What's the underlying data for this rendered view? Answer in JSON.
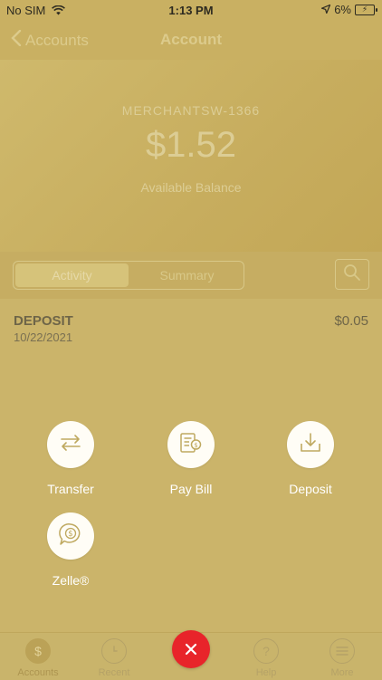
{
  "status_bar": {
    "carrier": "No SIM",
    "time": "1:13 PM",
    "battery": "6%"
  },
  "nav": {
    "back_label": "Accounts",
    "title": "Account"
  },
  "account": {
    "name": "MERCHANTSW-1366",
    "balance": "$1.52",
    "balance_label": "Available Balance"
  },
  "tabs_segment": {
    "activity": "Activity",
    "summary": "Summary"
  },
  "transactions": [
    {
      "title": "DEPOSIT",
      "date": "10/22/2021",
      "amount": "$0.05"
    }
  ],
  "quick_actions": [
    {
      "label": "Transfer",
      "icon": "transfer-icon"
    },
    {
      "label": "Pay Bill",
      "icon": "pay-bill-icon"
    },
    {
      "label": "Deposit",
      "icon": "deposit-icon"
    },
    {
      "label": "Zelle®",
      "icon": "zelle-icon"
    }
  ],
  "tab_bar": [
    {
      "label": "Accounts",
      "icon": "dollar-icon",
      "active": true
    },
    {
      "label": "Recent",
      "icon": "clock-icon"
    },
    {
      "label": "Help",
      "icon": "question-icon"
    },
    {
      "label": "More",
      "icon": "menu-icon"
    }
  ],
  "colors": {
    "close_button": "#e8242a",
    "overlay": "#cbb46a"
  }
}
